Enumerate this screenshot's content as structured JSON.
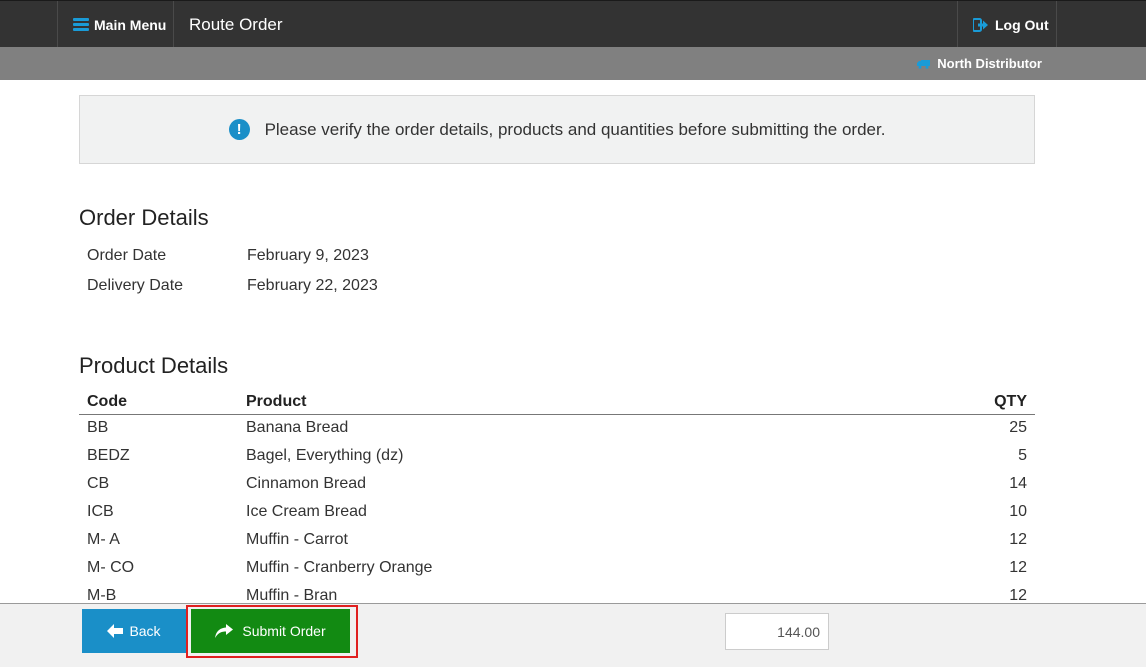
{
  "header": {
    "menu_label": "Main Menu",
    "page_title": "Route Order",
    "logout_label": "Log Out"
  },
  "subheader": {
    "distributor": "North Distributor"
  },
  "alert": {
    "message": "Please verify the order details, products and quantities before submitting the order."
  },
  "order_details": {
    "heading": "Order Details",
    "order_date_label": "Order Date",
    "order_date": "February 9, 2023",
    "delivery_date_label": "Delivery Date",
    "delivery_date": "February 22, 2023"
  },
  "product_details": {
    "heading": "Product Details",
    "columns": {
      "code": "Code",
      "product": "Product",
      "qty": "QTY"
    },
    "rows": [
      {
        "code": "BB",
        "product": "Banana Bread",
        "qty": "25"
      },
      {
        "code": "BEDZ",
        "product": "Bagel, Everything (dz)",
        "qty": "5"
      },
      {
        "code": "CB",
        "product": "Cinnamon Bread",
        "qty": "14"
      },
      {
        "code": "ICB",
        "product": "Ice Cream Bread",
        "qty": "10"
      },
      {
        "code": "M- A",
        "product": "Muffin - Carrot",
        "qty": "12"
      },
      {
        "code": "M- CO",
        "product": "Muffin - Cranberry Orange",
        "qty": "12"
      },
      {
        "code": "M-B",
        "product": "Muffin - Bran",
        "qty": "12"
      }
    ]
  },
  "footer": {
    "back_label": "Back",
    "submit_label": "Submit Order",
    "total": "144.00"
  },
  "colors": {
    "topbar": "#333333",
    "subbar": "#808080",
    "accent_blue": "#1a8fc8",
    "submit_green": "#128a12",
    "highlight_red": "#e02020"
  }
}
